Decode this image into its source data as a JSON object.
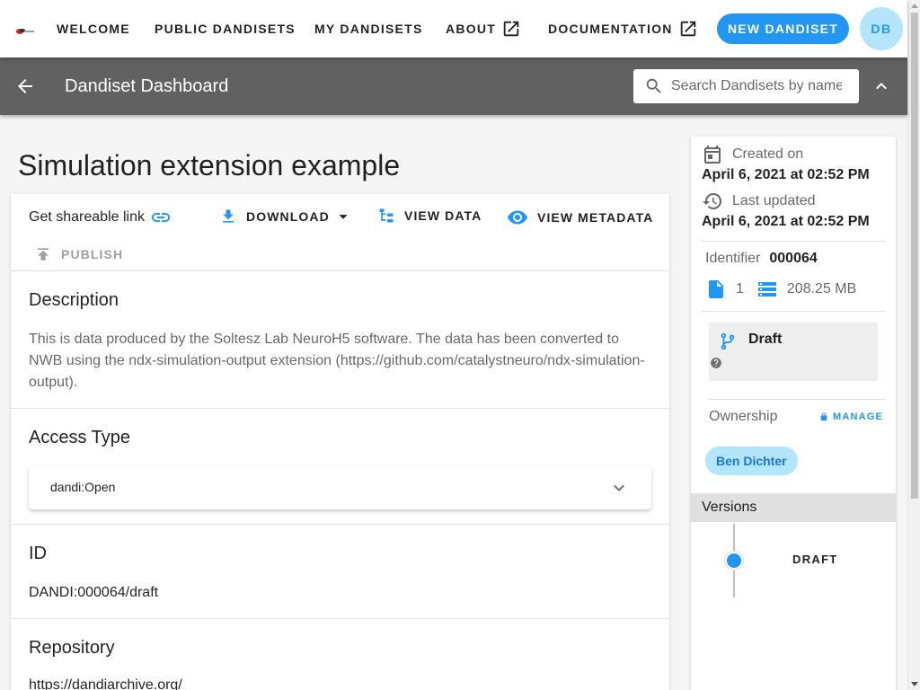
{
  "nav": {
    "items": [
      {
        "label": "Welcome",
        "external": false
      },
      {
        "label": "Public Dandisets",
        "external": false
      },
      {
        "label": "My Dandisets",
        "external": false
      },
      {
        "label": "About",
        "external": true
      },
      {
        "label": "Documentation",
        "external": true
      }
    ],
    "new_button": "New Dandiset",
    "user_initials": "DB"
  },
  "toolbar": {
    "title": "Dandiset Dashboard",
    "search_placeholder": "Search Dandisets by name, description, ID or contributor name"
  },
  "dandiset": {
    "title": "Simulation extension example"
  },
  "actions": {
    "share": "Get shareable link",
    "download": "Download",
    "view_data": "View Data",
    "view_metadata": "View Metadata",
    "publish": "Publish"
  },
  "sections": {
    "description": {
      "title": "Description",
      "text": "This is data produced by the Soltesz Lab NeuroH5 software. The data has been converted to NWB using the ndx-simulation-output extension (https://github.com/catalystneuro/ndx-simulation-output)."
    },
    "access": {
      "title": "Access Type",
      "value": "dandi:Open"
    },
    "id": {
      "title": "ID",
      "value": "DANDI:000064/draft"
    },
    "repository": {
      "title": "Repository",
      "value": "https://dandiarchive.org/"
    }
  },
  "sidebar": {
    "created_label": "Created on",
    "created_value": "April 6, 2021 at 02:52 PM",
    "updated_label": "Last updated",
    "updated_value": "April 6, 2021 at 02:52 PM",
    "identifier_label": "Identifier",
    "identifier_value": "000064",
    "file_count": "1",
    "size": "208.25 MB",
    "status": "Draft",
    "ownership_label": "Ownership",
    "manage_label": "MANAGE",
    "owner": "Ben Dichter",
    "versions_label": "Versions",
    "versions": [
      {
        "label": "DRAFT"
      }
    ]
  },
  "colors": {
    "accent": "#2196f3",
    "toolbar_bg": "#616161",
    "chip_bg": "#b3e5fc"
  }
}
